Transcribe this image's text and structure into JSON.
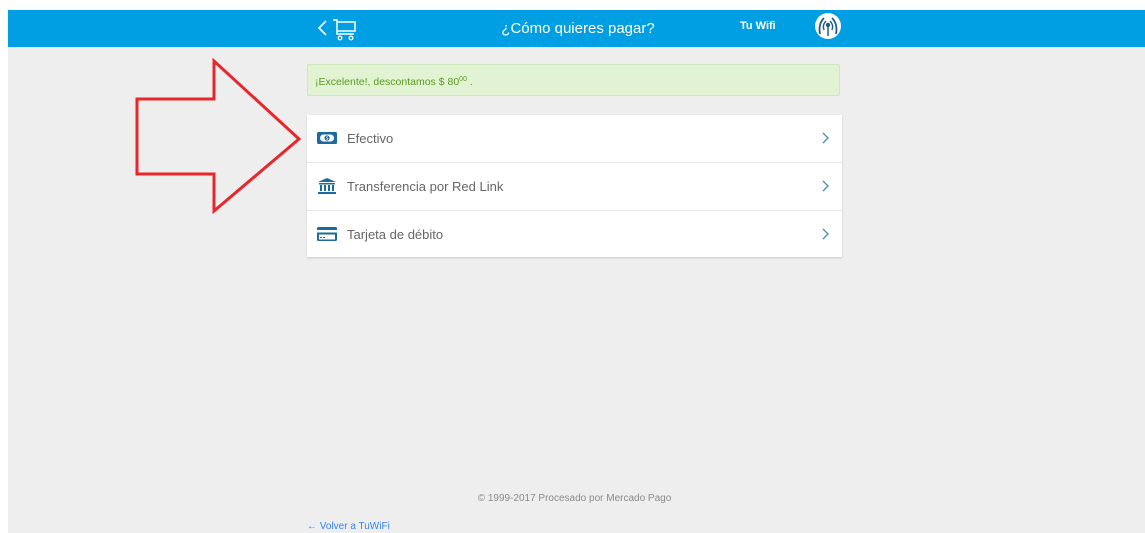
{
  "header": {
    "title": "¿Cómo quieres pagar?",
    "brand_name": "Tu Wifi",
    "background_color": "#009ee3"
  },
  "alert": {
    "text": "¡Excelente!, descontamos $ 80",
    "cents": "00",
    "suffix": " .",
    "color": "#5a9a1f",
    "background_color": "#e2f3d4"
  },
  "payment_methods": [
    {
      "label": "Efectivo",
      "icon": "cash-icon"
    },
    {
      "label": "Transferencia por Red Link",
      "icon": "bank-icon"
    },
    {
      "label": "Tarjeta de débito",
      "icon": "debit-card-icon"
    }
  ],
  "footer": {
    "copyright": "© 1999-2017 Procesado por Mercado Pago",
    "back_link": "← Volver a TuWiFi"
  },
  "annotation": {
    "shape": "arrow-right",
    "color": "#e8262b"
  }
}
